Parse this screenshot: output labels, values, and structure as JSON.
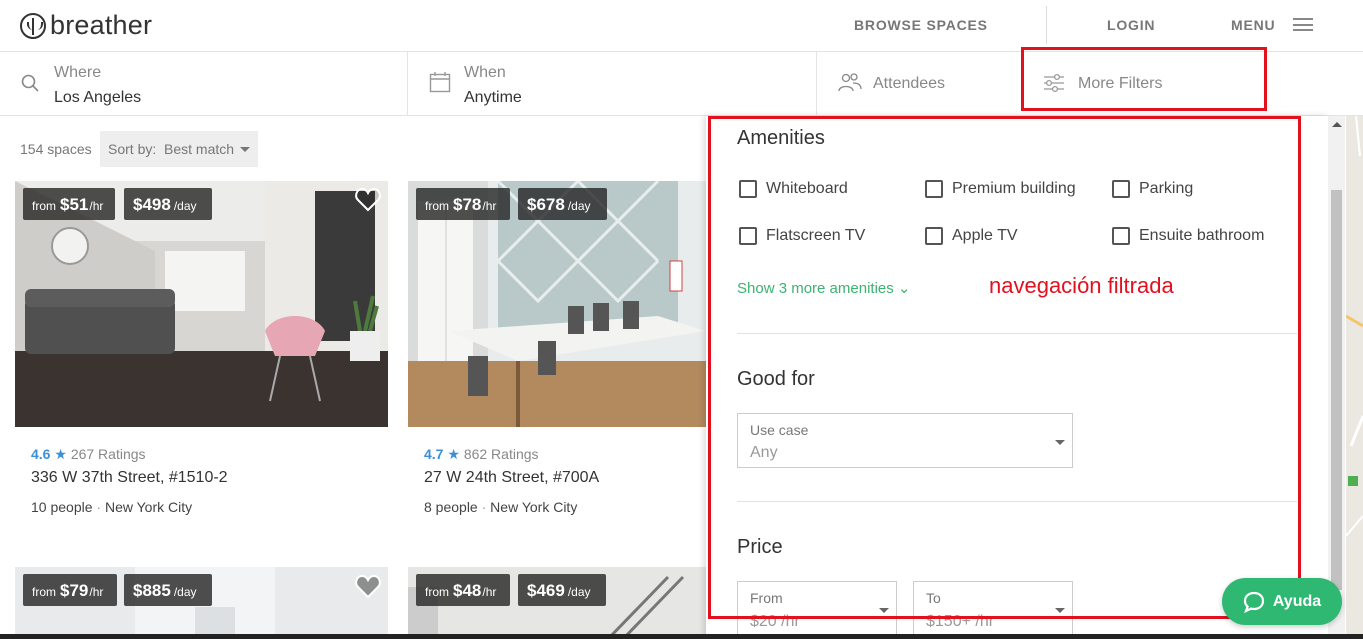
{
  "brand": {
    "name": "breather"
  },
  "nav": {
    "browse": "BROWSE SPACES",
    "login": "LOGIN",
    "menu": "MENU"
  },
  "search": {
    "where_label": "Where",
    "where_value": "Los Angeles",
    "when_label": "When",
    "when_value": "Anytime",
    "attendees_label": "Attendees",
    "filters_label": "More Filters"
  },
  "results": {
    "count": "154 spaces",
    "sort_label": "Sort by:",
    "sort_value": "Best match"
  },
  "cards": [
    {
      "hourly_prefix": "from",
      "hourly": "$51",
      "hourly_unit": "/hr",
      "daily": "$498",
      "daily_unit": "/day",
      "rating": "4.6",
      "ratings_count": "267 Ratings",
      "address": "336 W 37th Street, #1510-2",
      "people": "10 people",
      "city": "New York City"
    },
    {
      "hourly_prefix": "from",
      "hourly": "$78",
      "hourly_unit": "/hr",
      "daily": "$678",
      "daily_unit": "/day",
      "rating": "4.7",
      "ratings_count": "862 Ratings",
      "address": "27 W 24th Street, #700A",
      "people": "8 people",
      "city": "New York City"
    },
    {
      "hourly_prefix": "from",
      "hourly": "$79",
      "hourly_unit": "/hr",
      "daily": "$885",
      "daily_unit": "/day"
    },
    {
      "hourly_prefix": "from",
      "hourly": "$48",
      "hourly_unit": "/hr",
      "daily": "$469",
      "daily_unit": "/day"
    }
  ],
  "filters": {
    "amenities_title": "Amenities",
    "amenities": [
      "Whiteboard",
      "Premium building",
      "Parking",
      "Flatscreen TV",
      "Apple TV",
      "Ensuite bathroom"
    ],
    "show_more": "Show 3 more amenities ⌄",
    "good_for_title": "Good for",
    "use_case_label": "Use case",
    "use_case_value": "Any",
    "price_title": "Price",
    "price_from_label": "From",
    "price_from_value": "$20 /hr",
    "price_to_label": "To",
    "price_to_value": "$150+ /hr"
  },
  "annotation": "navegación filtrada",
  "help": {
    "label": "Ayuda"
  },
  "colors": {
    "accent_green": "#3cb371",
    "rating_blue": "#3d8fd6",
    "annotation_red": "#e3101e",
    "help_green": "#2eb872"
  }
}
